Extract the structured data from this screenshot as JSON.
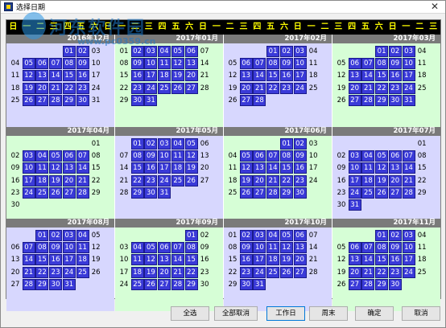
{
  "window": {
    "title": "选择日期",
    "close_glyph": "✕"
  },
  "watermark": {
    "line1": "河东软件园",
    "line2": "www.pc0359.cn"
  },
  "weekdays": [
    "日",
    "一",
    "二",
    "三",
    "四",
    "五",
    "六",
    "日",
    "一",
    "二",
    "三",
    "四",
    "五",
    "六",
    "日",
    "一",
    "二",
    "三",
    "四",
    "五",
    "六",
    "日",
    "一",
    "二",
    "三",
    "四",
    "五",
    "六",
    "日",
    "一",
    "二",
    "三"
  ],
  "months": [
    {
      "label": "2016年12月",
      "first_col": 4,
      "days": 31,
      "weeknums": [
        "",
        "04",
        "11",
        "18",
        "25"
      ]
    },
    {
      "label": "2017年01月",
      "first_col": 0,
      "days": 31
    },
    {
      "label": "2017年02月",
      "first_col": 3,
      "days": 28
    },
    {
      "label": "2017年03月",
      "first_col": 3,
      "days": 31
    },
    {
      "label": "2017年04月",
      "first_col": 6,
      "days": 30
    },
    {
      "label": "2017年05月",
      "first_col": 1,
      "days": 31
    },
    {
      "label": "2017年06月",
      "first_col": 4,
      "days": 30
    },
    {
      "label": "2017年07月",
      "first_col": 6,
      "days": 31
    },
    {
      "label": "2017年08月",
      "first_col": 2,
      "days": 31
    },
    {
      "label": "2017年09月",
      "first_col": 5,
      "days": 30
    },
    {
      "label": "2017年10月",
      "first_col": 0,
      "days": 31
    },
    {
      "label": "2017年11月",
      "first_col": 3,
      "days": 30
    }
  ],
  "buttons": {
    "select_all": "全选",
    "deselect_all": "全部取消",
    "workday": "工作日",
    "weekend": "周末",
    "ok": "确定",
    "cancel": "取消"
  },
  "colors": {
    "workday_fill": "#3a3ad8",
    "month_bg_a": "#d7d7fe",
    "month_bg_b": "#d6fed6",
    "header_gray": "#7a7a7a",
    "weekday_text": "#ffff00"
  }
}
